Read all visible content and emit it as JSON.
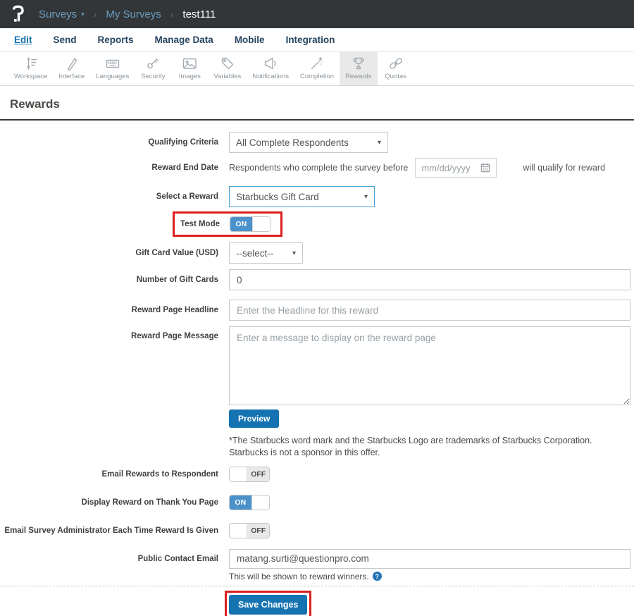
{
  "topbar": {
    "breadcrumb": {
      "surveys": "Surveys",
      "my_surveys": "My Surveys",
      "survey_name": "test111"
    }
  },
  "nav": {
    "tabs": [
      {
        "label": "Edit",
        "active": true
      },
      {
        "label": "Send",
        "active": false
      },
      {
        "label": "Reports",
        "active": false
      },
      {
        "label": "Manage Data",
        "active": false
      },
      {
        "label": "Mobile",
        "active": false
      },
      {
        "label": "Integration",
        "active": false
      }
    ]
  },
  "toolbar": {
    "items": [
      {
        "label": "Workspace",
        "icon": "pen-list-icon",
        "active": false
      },
      {
        "label": "Interface",
        "icon": "brush-icon",
        "active": false
      },
      {
        "label": "Languages",
        "icon": "keyboard-icon",
        "active": false
      },
      {
        "label": "Security",
        "icon": "key-icon",
        "active": false
      },
      {
        "label": "Images",
        "icon": "image-icon",
        "active": false
      },
      {
        "label": "Variables",
        "icon": "tag-icon",
        "active": false
      },
      {
        "label": "Notifications",
        "icon": "megaphone-icon",
        "active": false
      },
      {
        "label": "Completion",
        "icon": "wand-icon",
        "active": false
      },
      {
        "label": "Rewards",
        "icon": "trophy-icon",
        "active": true
      },
      {
        "label": "Quotas",
        "icon": "chain-icon",
        "active": false
      }
    ]
  },
  "page": {
    "title": "Rewards"
  },
  "form": {
    "qualifying_criteria": {
      "label": "Qualifying Criteria",
      "value": "All Complete Respondents"
    },
    "reward_end_date": {
      "label": "Reward End Date",
      "prefix": "Respondents who complete the survey before",
      "date_placeholder": "mm/dd/yyyy",
      "suffix": "will qualify for reward"
    },
    "select_reward": {
      "label": "Select a Reward",
      "value": "Starbucks Gift Card"
    },
    "test_mode": {
      "label": "Test Mode",
      "state": "ON",
      "state_label": "ON"
    },
    "gift_card_value": {
      "label": "Gift Card Value (USD)",
      "value": "--select--"
    },
    "number_of_gift_cards": {
      "label": "Number of Gift Cards",
      "value": "0"
    },
    "reward_page_headline": {
      "label": "Reward Page Headline",
      "placeholder": "Enter the Headline for this reward"
    },
    "reward_page_message": {
      "label": "Reward Page Message",
      "placeholder": "Enter a message to display on the reward page"
    },
    "preview_button": "Preview",
    "disclaimer": "*The Starbucks word mark and the Starbucks Logo are trademarks of Starbucks Corporation. Starbucks is not a sponsor in this offer.",
    "email_rewards_to_respondent": {
      "label": "Email Rewards to Respondent",
      "state": "OFF",
      "state_label": "OFF"
    },
    "display_reward_on_thank_you": {
      "label": "Display Reward on Thank You Page",
      "state": "ON",
      "state_label": "ON"
    },
    "email_survey_admin": {
      "label": "Email Survey Administrator Each Time Reward Is Given",
      "state": "OFF",
      "state_label": "OFF"
    },
    "public_contact_email": {
      "label": "Public Contact Email",
      "value": "matang.surti@questionpro.com",
      "helper": "This will be shown to reward winners."
    },
    "save_button": "Save Changes"
  },
  "colors": {
    "brand_blue": "#1673b2",
    "toggle_blue": "#4b92cb",
    "annotation_red": "#dc1f1f",
    "topbar_bg": "#323639"
  }
}
